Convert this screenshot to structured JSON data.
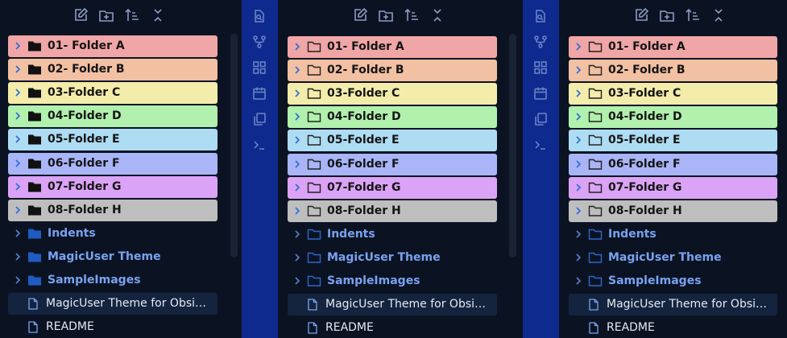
{
  "colors": {
    "background": "#0b1323",
    "ribbon": "#0e2a8f",
    "folder_rows": [
      "#f0a6a6",
      "#f2c0a2",
      "#f3ecaa",
      "#b1f0ad",
      "#aedcf3",
      "#a9b5f7",
      "#dba3f5",
      "#bebebe"
    ],
    "subfolder_text": "#7aa2f0",
    "file_highlight": "#14243f"
  },
  "ribbon_icons": [
    "file-search-icon",
    "git-fork-icon",
    "layout-grid-icon",
    "calendar-icon",
    "copy-icon",
    "terminal-icon"
  ],
  "toolbar_icons": [
    "new-note-icon",
    "new-folder-icon",
    "sort-icon",
    "collapse-all-icon"
  ],
  "folders": [
    "01- Folder A",
    "02- Folder B",
    "03-Folder C",
    "04-Folder D",
    "05-Folder E",
    "06-Folder F",
    "07-Folder G",
    "08-Folder H"
  ],
  "subfolders": [
    "Indents",
    "MagicUser Theme",
    "SampleImages"
  ],
  "files": [
    "MagicUser Theme for Obsidian",
    "README"
  ],
  "panes": [
    {
      "folder_icon_style": "filled"
    },
    {
      "folder_icon_style": "outline"
    },
    {
      "folder_icon_style": "outline"
    }
  ]
}
